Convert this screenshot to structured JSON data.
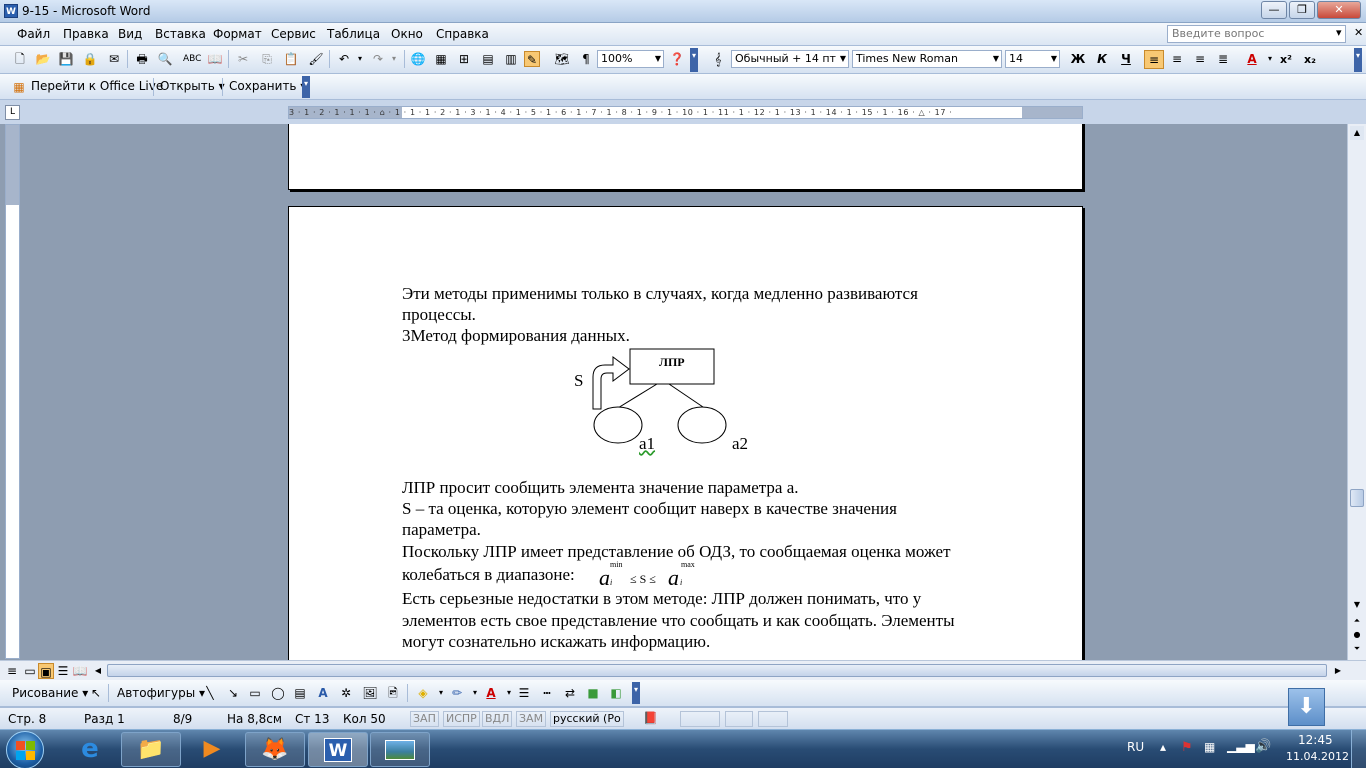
{
  "window": {
    "title": "9-15 - Microsoft Word",
    "app_icon": "W"
  },
  "window_buttons": [
    "—",
    "❐",
    "✕"
  ],
  "menu": {
    "items": [
      "Файл",
      "Правка",
      "Вид",
      "Вставка",
      "Формат",
      "Сервис",
      "Таблица",
      "Окно",
      "Справка"
    ],
    "ask_placeholder": "Введите вопрос",
    "close_doc": "✕"
  },
  "toolbar": {
    "zoom": "100%",
    "style": "Обычный + 14 пт",
    "font": "Times New Roman",
    "size": "14",
    "bold": "Ж",
    "italic": "К",
    "underline": "Ч"
  },
  "toolbar2": {
    "office_live": "Перейти к Office Live",
    "open": "Открыть",
    "save": "Сохранить"
  },
  "ruler": {
    "marks": "3 · 1 · 2 · 1 · 1 · 1 · ⌂ · 1 · 1 · 1 · 2 · 1 · 3 · 1 · 4 · 1 · 5 · 1 · 6 · 1 · 7 · 1 · 8 · 1 · 9 · 1 · 10 · 1 · 11 · 1 · 12 · 1 · 13 · 1 · 14 · 1 · 15 · 1 · 16 · △ · 17 ·",
    "corner": "L"
  },
  "document": {
    "lines": [
      "Эти методы применимы только в случаях, когда медленно развиваются",
      "процессы.",
      "3Метод формирования данных."
    ],
    "diagram": {
      "box": "ЛПР",
      "s": "S",
      "a1": "a1",
      "a2": "a2"
    },
    "lines2": [
      "ЛПР просит сообщить элемента значение параметра а.",
      "S – та оценка, которую элемент сообщит наверх в качестве значения",
      "параметра.",
      "Поскольку ЛПР имеет представление об ОДЗ, то сообщаемая оценка может",
      "колебаться в диапазоне:"
    ],
    "formula": {
      "a": "a",
      "i": "i",
      "min": "min",
      "max": "max",
      "mid": "≤ S ≤"
    },
    "lines3": [
      "Есть серьезные недостатки в этом методе: ЛПР должен понимать, что у",
      "элементов есть свое представление что сообщать и как сообщать. Элементы",
      "могут сознательно искажать информацию."
    ]
  },
  "drawbar": {
    "drawing": "Рисование",
    "autoshapes": "Автофигуры"
  },
  "status": {
    "page": "Стр. 8",
    "section": "Разд 1",
    "pages": "8/9",
    "at": "На 8,8см",
    "line": "Ст 13",
    "col": "Кол 50",
    "rec": "ЗАП",
    "trk": "ИСПР",
    "ext": "ВДЛ",
    "ovr": "ЗАМ",
    "lang": "русский (Ро"
  },
  "taskbar": {
    "lang": "RU",
    "time": "12:45",
    "date": "11.04.2012"
  }
}
